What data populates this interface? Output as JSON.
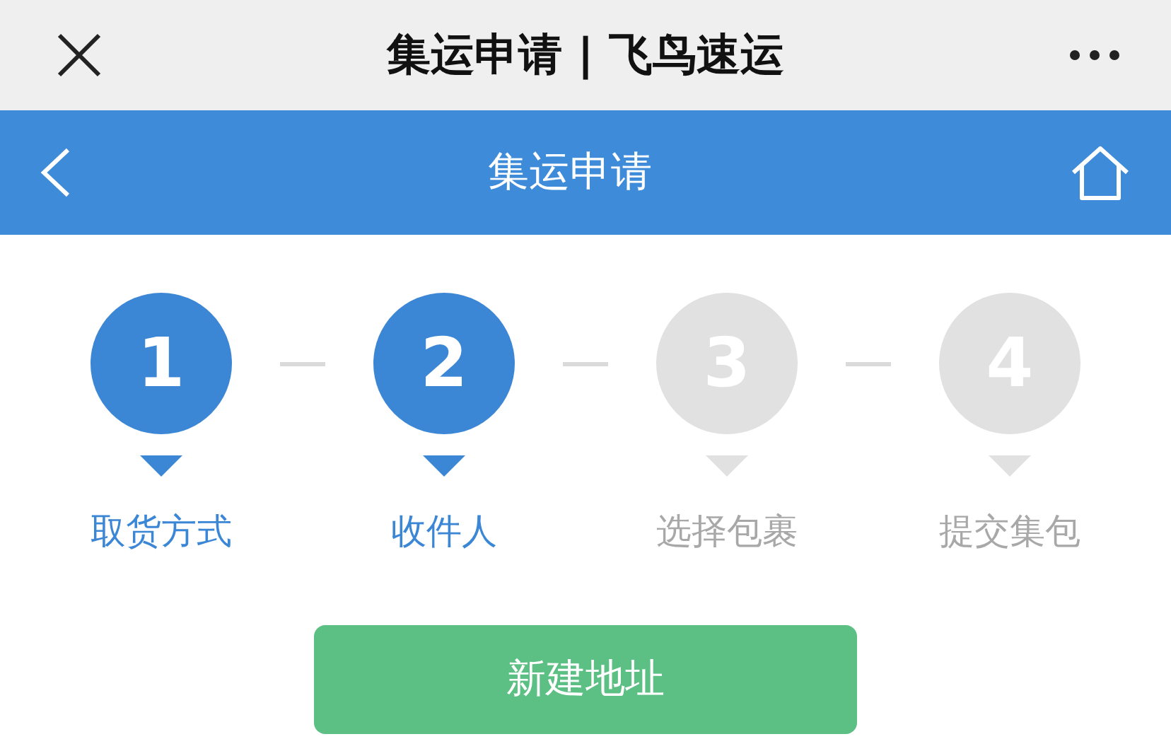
{
  "window": {
    "title": "集运申请 | 飞鸟速运"
  },
  "header": {
    "title": "集运申请"
  },
  "steps": [
    {
      "number": "1",
      "label": "取货方式",
      "active": true
    },
    {
      "number": "2",
      "label": "收件人",
      "active": true
    },
    {
      "number": "3",
      "label": "选择包裹",
      "active": false
    },
    {
      "number": "4",
      "label": "提交集包",
      "active": false
    }
  ],
  "button": "新建地址"
}
